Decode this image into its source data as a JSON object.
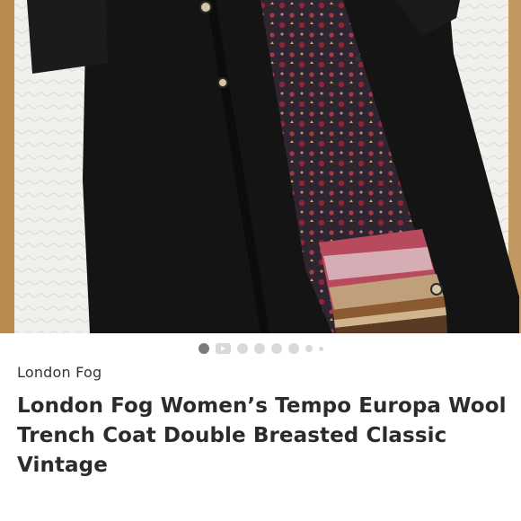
{
  "listing": {
    "brand": "London Fog",
    "title": "London Fog Women’s Tempo Europa Wool Trench Coat Double Breasted Classic Vintage"
  },
  "photo": {
    "subject": "coat-photo",
    "colors": {
      "coat": "#141414",
      "lining_bg": "#2e2530",
      "lining_accent": "#8e2436",
      "border_stripe": "#8a5a32",
      "background": "#f0efea",
      "wood": "#b88a4e"
    }
  },
  "carousel": {
    "active_index": 0,
    "items": [
      "image",
      "video",
      "image",
      "image",
      "image",
      "image",
      "image",
      "image"
    ]
  }
}
